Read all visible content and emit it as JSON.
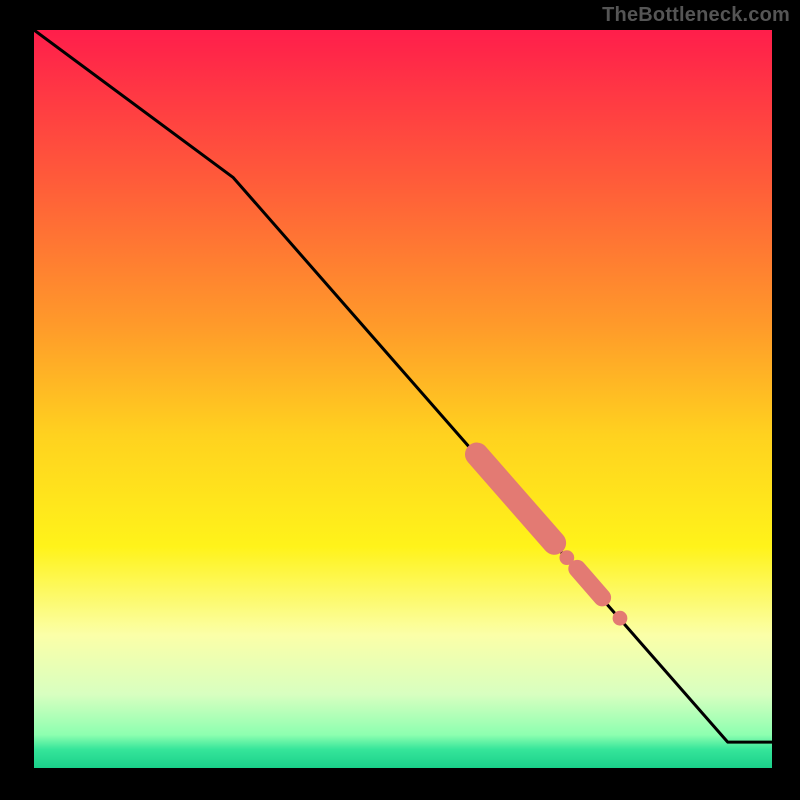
{
  "watermark": "TheBottleneck.com",
  "colors": {
    "bg": "#000000",
    "line": "#000000",
    "marker": "#e37a73",
    "watermark": "#555555"
  },
  "chart_data": {
    "type": "line",
    "title": "",
    "xlabel": "",
    "ylabel": "",
    "xlim": [
      0,
      100
    ],
    "ylim": [
      0,
      100
    ],
    "grid": false,
    "legend": false,
    "gradient_stops": [
      {
        "pos": 0.0,
        "color": "#ff1e4b"
      },
      {
        "pos": 0.2,
        "color": "#ff5a3a"
      },
      {
        "pos": 0.4,
        "color": "#ff9a2a"
      },
      {
        "pos": 0.55,
        "color": "#ffd21f"
      },
      {
        "pos": 0.7,
        "color": "#fff31a"
      },
      {
        "pos": 0.82,
        "color": "#fbffa8"
      },
      {
        "pos": 0.9,
        "color": "#d8ffc0"
      },
      {
        "pos": 0.955,
        "color": "#8dffb0"
      },
      {
        "pos": 0.975,
        "color": "#35e59a"
      },
      {
        "pos": 1.0,
        "color": "#1ad08a"
      }
    ],
    "series": [
      {
        "name": "curve",
        "x": [
          0,
          27,
          94,
          100
        ],
        "y": [
          100,
          80,
          3.5,
          3.5
        ]
      }
    ],
    "markers": [
      {
        "shape": "capsule",
        "x0": 60.0,
        "y0": 42.5,
        "x1": 70.5,
        "y1": 30.5,
        "r": 1.6
      },
      {
        "shape": "circle",
        "cx": 72.2,
        "cy": 28.5,
        "r": 1.0
      },
      {
        "shape": "capsule",
        "x0": 73.6,
        "y0": 27.0,
        "x1": 77.0,
        "y1": 23.1,
        "r": 1.2
      },
      {
        "shape": "circle",
        "cx": 79.4,
        "cy": 20.3,
        "r": 1.0
      }
    ]
  }
}
